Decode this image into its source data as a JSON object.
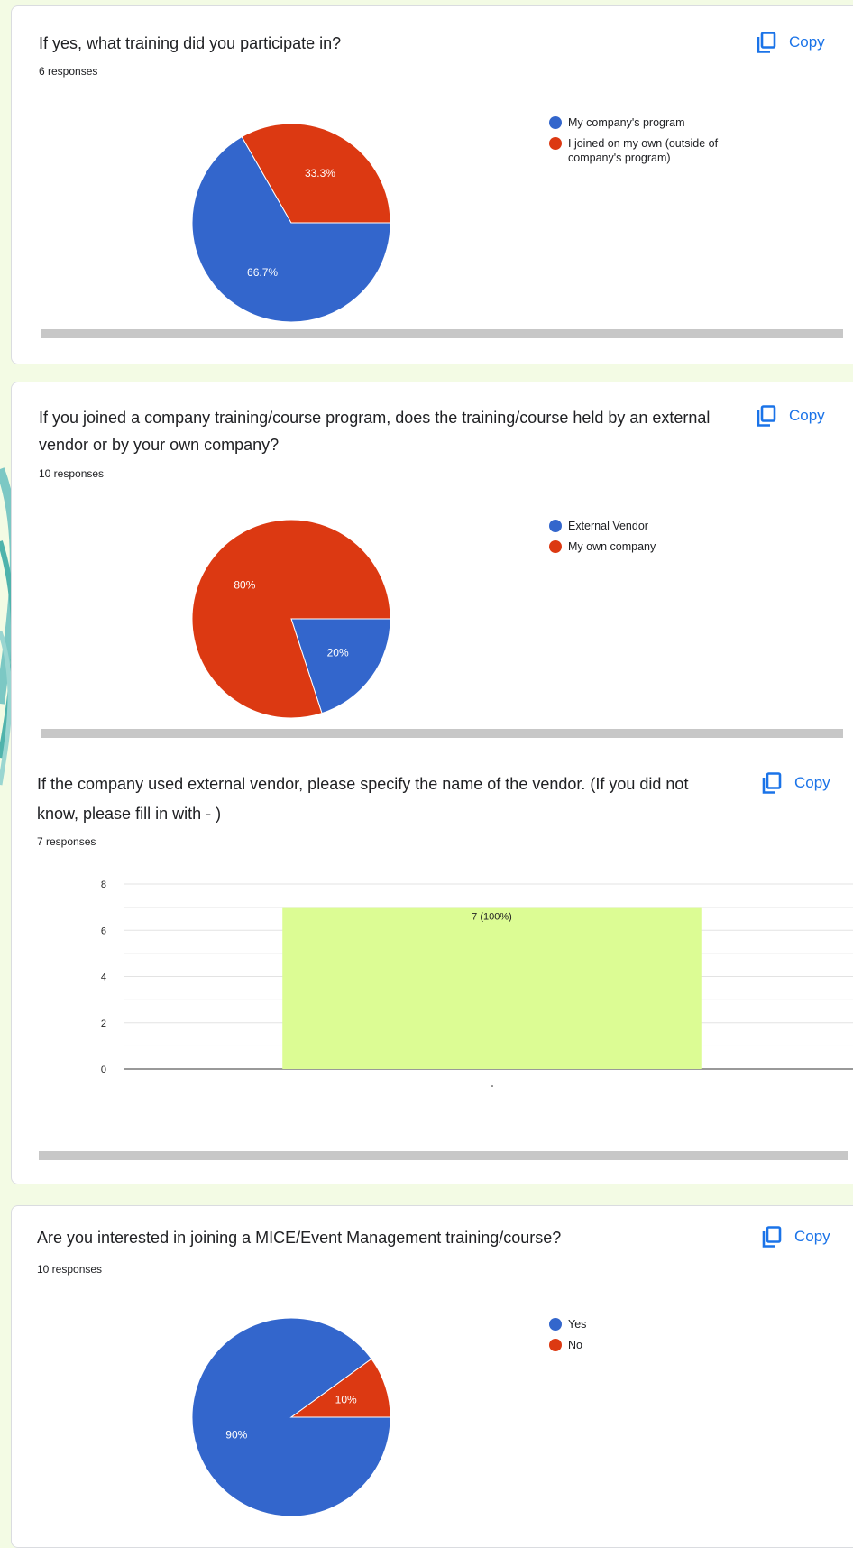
{
  "copy_label": "Copy",
  "colors": {
    "blue": "#3366cc",
    "red": "#dc3912",
    "lime": "#dcfc94",
    "accent": "#1a73e8"
  },
  "questions": [
    {
      "title": "If yes, what training did you participate in?",
      "responses": "6 responses",
      "chart_data": {
        "type": "pie",
        "slices": [
          {
            "label": "My company's program",
            "value": 66.7,
            "display": "66.7%",
            "color": "#3366cc"
          },
          {
            "label": "I joined on my own (outside of company's program)",
            "value": 33.3,
            "display": "33.3%",
            "color": "#dc3912"
          }
        ],
        "legend_position": "right"
      }
    },
    {
      "title": "If you joined a company training/course program, does the training/course held by an external vendor or by your own company?",
      "responses": "10 responses",
      "chart_data": {
        "type": "pie",
        "slices": [
          {
            "label": "External Vendor",
            "value": 20,
            "display": "20%",
            "color": "#3366cc"
          },
          {
            "label": "My own company",
            "value": 80,
            "display": "80%",
            "color": "#dc3912"
          }
        ],
        "legend_position": "right"
      }
    },
    {
      "title": "If the company used external vendor, please specify the name of the vendor. (If you did not know, please fill in with - )",
      "responses": "7 responses",
      "chart_data": {
        "type": "bar",
        "categories": [
          "-"
        ],
        "values": [
          7
        ],
        "data_labels": [
          "7 (100%)"
        ],
        "ylim": [
          0,
          8
        ],
        "yticks": [
          0,
          2,
          4,
          6,
          8
        ],
        "grid": true,
        "color": "#dcfc94"
      }
    },
    {
      "title": "Are you interested in joining a MICE/Event Management training/course?",
      "responses": "10 responses",
      "chart_data": {
        "type": "pie",
        "slices": [
          {
            "label": "Yes",
            "value": 90,
            "display": "90%",
            "color": "#3366cc"
          },
          {
            "label": "No",
            "value": 10,
            "display": "10%",
            "color": "#dc3912"
          }
        ],
        "legend_position": "right"
      }
    }
  ]
}
